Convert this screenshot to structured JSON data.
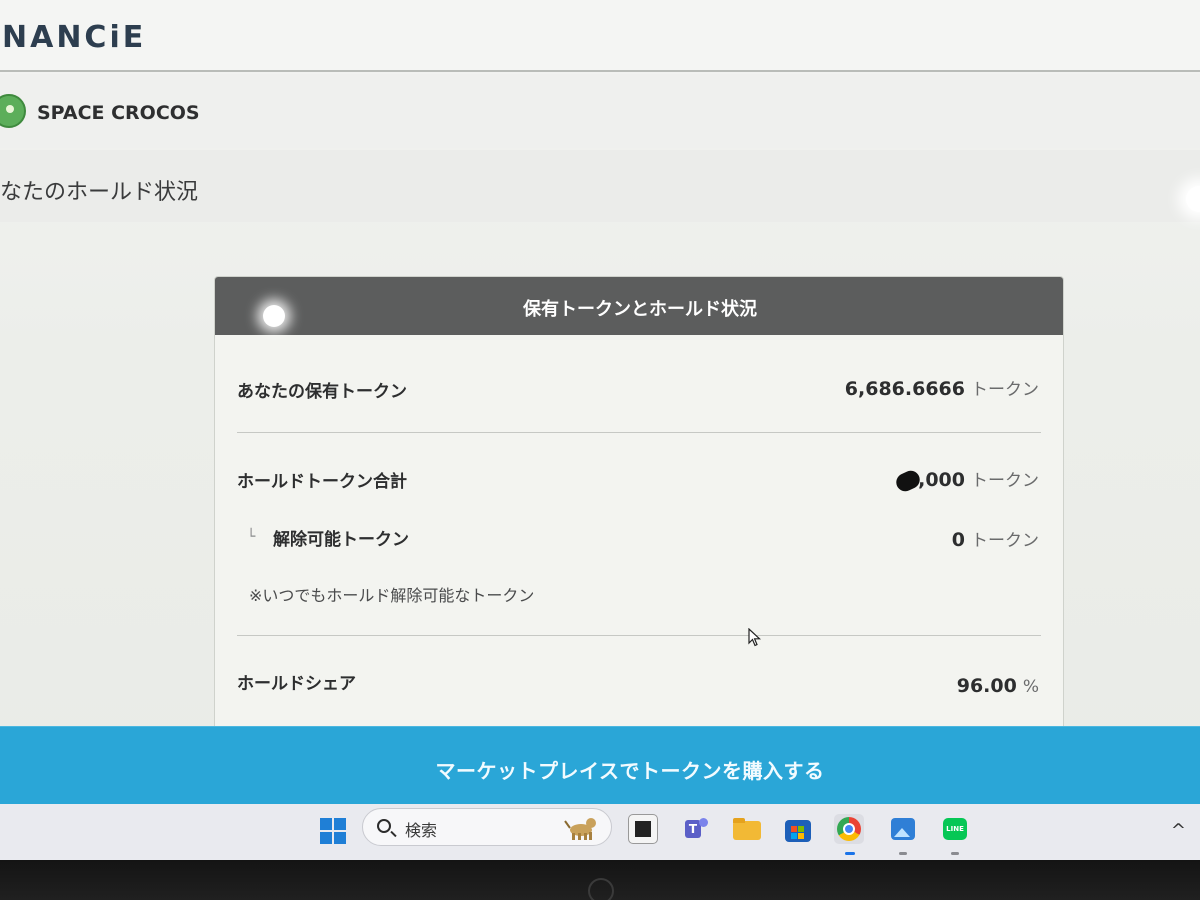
{
  "site": {
    "logo": "NANCiE",
    "project_name": "SPACE CROCOS",
    "page_heading": "なたのホールド状況"
  },
  "card": {
    "title": "保有トークンとホールド状況",
    "rows": {
      "owned": {
        "label": "あなたの保有トークン",
        "value": "6,686.6666",
        "unit": "トークン"
      },
      "hold_total": {
        "label": "ホールドトークン合計",
        "value": ",000",
        "unit": "トークン"
      },
      "releasable": {
        "prefix": "└",
        "label": "解除可能トークン",
        "value": "0",
        "unit": "トークン"
      },
      "note": "※いつでもホールド解除可能なトークン",
      "hold_share": {
        "label": "ホールドシェア",
        "value": "96.00",
        "unit": "%"
      }
    }
  },
  "cta": {
    "label": "マーケットプレイスでトークンを購入する"
  },
  "taskbar": {
    "search_placeholder": "検索",
    "icons": [
      "windows-start-icon",
      "search-icon",
      "task-view-icon",
      "teams-icon",
      "file-explorer-icon",
      "microsoft-store-icon",
      "chrome-icon",
      "photos-icon",
      "line-icon"
    ],
    "tray_chevron": "^"
  },
  "colors": {
    "card_header": "#5c5d5d",
    "cta": "#2aa6d7",
    "logo": "#2d3e4f"
  }
}
